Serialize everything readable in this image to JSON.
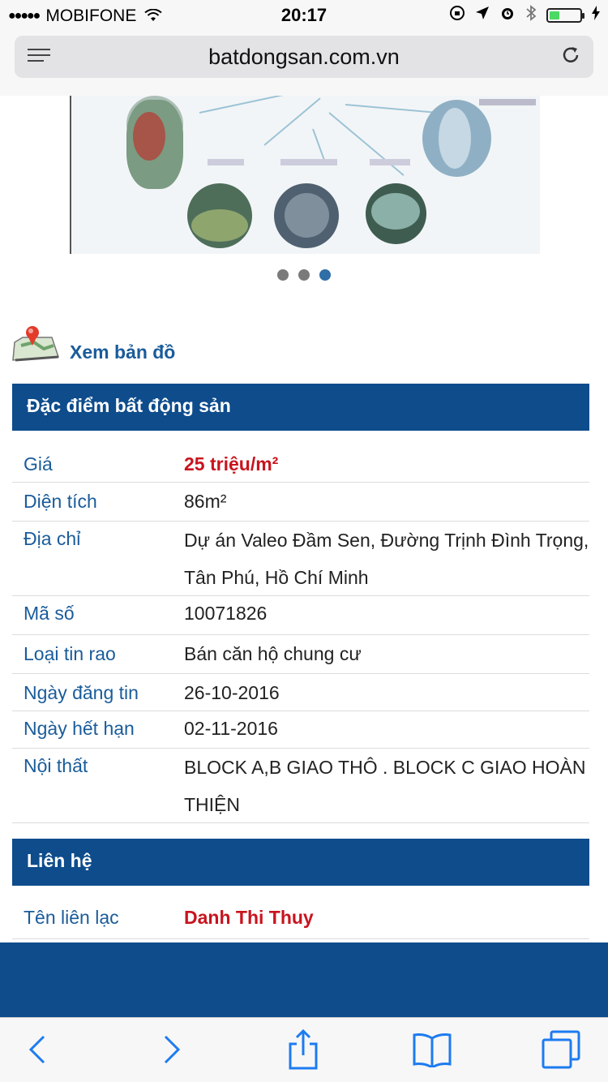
{
  "status_bar": {
    "signal": "●●●●●",
    "carrier": "MOBIFONE",
    "time": "20:17"
  },
  "browser": {
    "url": "batdongsan.com.vn"
  },
  "carousel": {
    "slide_count": 3,
    "active_index": 2
  },
  "map_link": {
    "label": "Xem bản đồ"
  },
  "property_section": {
    "title": "Đặc điểm bất động sản",
    "rows": [
      {
        "label": "Giá",
        "value": "25 triệu/m²"
      },
      {
        "label": "Diện tích",
        "value": "86m²"
      },
      {
        "label": "Địa chỉ",
        "value": "Dự án Valeo Đầm Sen, Đường Trịnh Đình Trọng, Tân Phú, Hồ Chí Minh"
      },
      {
        "label": "Mã số",
        "value": "10071826"
      },
      {
        "label": "Loại tin rao",
        "value": "Bán căn hộ chung cư"
      },
      {
        "label": "Ngày đăng tin",
        "value": "26-10-2016"
      },
      {
        "label": "Ngày hết hạn",
        "value": "02-11-2016"
      },
      {
        "label": "Nội thất",
        "value": "BLOCK A,B GIAO THÔ . BLOCK C GIAO HOÀN THIỆN"
      }
    ]
  },
  "contact_section": {
    "title": "Liên hệ",
    "rows": [
      {
        "label": "Tên liên lạc",
        "value": "Danh Thi Thuy"
      }
    ]
  },
  "colors": {
    "header_blue": "#0e4c8c",
    "label_blue": "#1a5c9a",
    "price_red": "#c8141e",
    "ios_blue": "#1d7bf0"
  }
}
